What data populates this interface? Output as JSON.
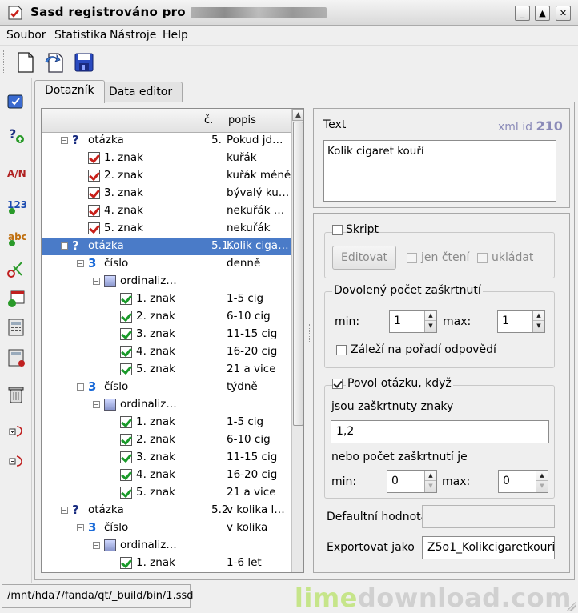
{
  "window": {
    "title": "Sasd  registrováno pro",
    "buttons": [
      "_",
      "▲",
      "✕"
    ]
  },
  "menu": [
    "Soubor",
    "Statistika",
    "Nástroje",
    "Help"
  ],
  "toolbar": [
    "new-document-icon",
    "open-icon",
    "save-icon"
  ],
  "sidebar": [
    "question-icon",
    "question-add-icon",
    "text-answer-icon",
    "number-answer-icon",
    "abc-answer-icon",
    "scissors-icon",
    "calendar-icon",
    "calculator-icon",
    "calculator-add-icon",
    "trash-icon",
    "move-down-icon",
    "move-up-icon"
  ],
  "tabs": [
    {
      "label": "Dotazník",
      "active": true
    },
    {
      "label": "Data editor",
      "active": false
    }
  ],
  "tree": {
    "columns": [
      "",
      "č.",
      "popis"
    ],
    "rows": [
      {
        "type": "question",
        "label": "otázka",
        "num": "5.",
        "desc": "Pokud jd…",
        "selected": false
      },
      {
        "type": "check-red",
        "label": "1. znak",
        "num": "",
        "desc": "kuřák",
        "selected": false
      },
      {
        "type": "check-red",
        "label": "2. znak",
        "num": "",
        "desc": "kuřák méně",
        "selected": false
      },
      {
        "type": "check-red",
        "label": "3. znak",
        "num": "",
        "desc": "bývalý ku…",
        "selected": false
      },
      {
        "type": "check-red",
        "label": "4. znak",
        "num": "",
        "desc": "nekuřák …",
        "selected": false
      },
      {
        "type": "check-red",
        "label": "5. znak",
        "num": "",
        "desc": "nekuřák",
        "selected": false
      },
      {
        "type": "question",
        "label": "otázka",
        "num": "5.1.",
        "desc": "Kolik ciga…",
        "selected": true
      },
      {
        "type": "number",
        "label": "číslo",
        "num": "",
        "desc": "denně",
        "selected": false
      },
      {
        "type": "ordinal",
        "label": "ordinaliz…",
        "num": "",
        "desc": "",
        "selected": false
      },
      {
        "type": "check-green",
        "label": "1. znak",
        "num": "",
        "desc": "1-5 cig",
        "selected": false
      },
      {
        "type": "check-green",
        "label": "2. znak",
        "num": "",
        "desc": "6-10 cig",
        "selected": false
      },
      {
        "type": "check-green",
        "label": "3. znak",
        "num": "",
        "desc": "11-15 cig",
        "selected": false
      },
      {
        "type": "check-green",
        "label": "4. znak",
        "num": "",
        "desc": "16-20 cig",
        "selected": false
      },
      {
        "type": "check-green",
        "label": "5. znak",
        "num": "",
        "desc": "21 a vice",
        "selected": false
      },
      {
        "type": "number",
        "label": "číslo",
        "num": "",
        "desc": "týdně",
        "selected": false
      },
      {
        "type": "ordinal",
        "label": "ordinaliz…",
        "num": "",
        "desc": "",
        "selected": false
      },
      {
        "type": "check-green",
        "label": "1. znak",
        "num": "",
        "desc": "1-5 cig",
        "selected": false
      },
      {
        "type": "check-green",
        "label": "2. znak",
        "num": "",
        "desc": "6-10 cig",
        "selected": false
      },
      {
        "type": "check-green",
        "label": "3. znak",
        "num": "",
        "desc": "11-15 cig",
        "selected": false
      },
      {
        "type": "check-green",
        "label": "4. znak",
        "num": "",
        "desc": "16-20 cig",
        "selected": false
      },
      {
        "type": "check-green",
        "label": "5. znak",
        "num": "",
        "desc": "21 a vice",
        "selected": false
      },
      {
        "type": "question",
        "label": "otázka",
        "num": "5.2.",
        "desc": "v kolika l…",
        "selected": false
      },
      {
        "type": "number",
        "label": "číslo",
        "num": "",
        "desc": "v kolika",
        "selected": false
      },
      {
        "type": "ordinal",
        "label": "ordinaliz…",
        "num": "",
        "desc": "",
        "selected": false
      },
      {
        "type": "check-green",
        "label": "1. znak",
        "num": "",
        "desc": "1-6 let",
        "selected": false
      }
    ]
  },
  "text_panel": {
    "label": "Text",
    "xml_label": "xml id",
    "xml_id": "210",
    "value": "Kolik cigaret kouří"
  },
  "script": {
    "label": "Skript",
    "edit_button": "Editovat",
    "readonly_label": "jen čtení",
    "save_label": "ukládat"
  },
  "allowed": {
    "title": "Dovolený počet zaškrtnutí",
    "min_label": "min:",
    "min_value": "1",
    "max_label": "max:",
    "max_value": "1",
    "order_label": "Záleží na pořadí odpovědí"
  },
  "enable": {
    "label": "Povol otázku, když",
    "checked": true,
    "checked_label": "jsou zaškrtnuty znaky",
    "checked_value": "1,2",
    "count_label": "nebo počet zaškrtnutí je",
    "min_label": "min:",
    "min_value": "0",
    "max_label": "max:",
    "max_value": "0"
  },
  "default": {
    "label": "Defaultní hodnota",
    "value": ""
  },
  "export": {
    "label": "Exportovat jako",
    "value": "Z5o1_Kolikcigaretkouri"
  },
  "status": {
    "path": "/mnt/hda7/fanda/qt/_build/bin/1.ssd"
  },
  "watermark": {
    "part1": "lime",
    "part2": "download.com"
  }
}
